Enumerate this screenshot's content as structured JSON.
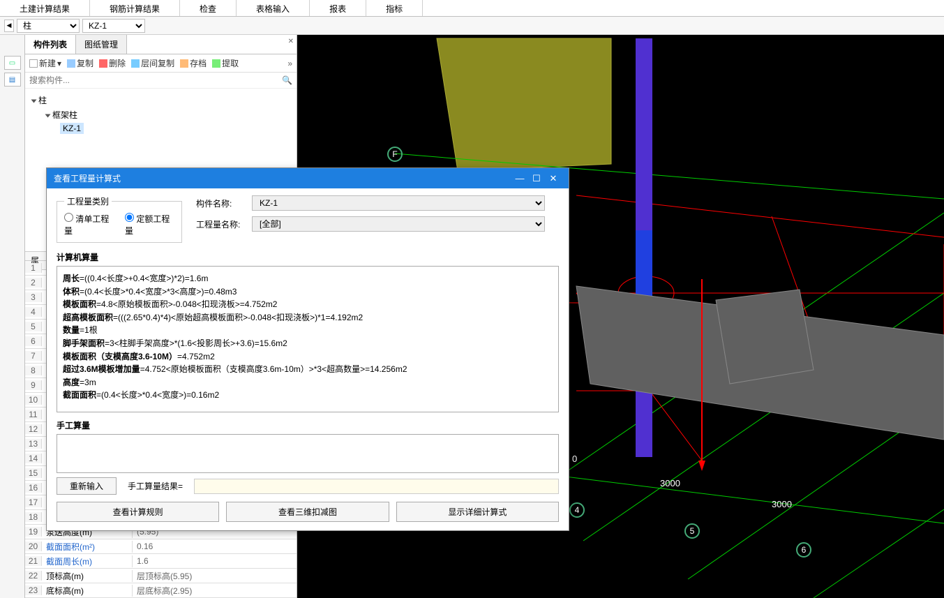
{
  "top_tabs": [
    "土建计算结果",
    "钢筋计算结果",
    "检查",
    "表格输入",
    "报表",
    "指标"
  ],
  "selectors": {
    "type": "柱",
    "name": "KZ-1"
  },
  "panel": {
    "tabs": [
      "构件列表",
      "图纸管理"
    ],
    "tools": {
      "new": "新建",
      "copy": "复制",
      "delete": "删除",
      "layer_copy": "层间复制",
      "archive": "存档",
      "extract": "提取"
    },
    "search_placeholder": "搜索构件...",
    "tree_root": "柱",
    "tree_child": "框架柱",
    "tree_leaf": "KZ-1",
    "prop_header": "属",
    "rows": [
      {
        "n": "1"
      },
      {
        "n": "2"
      },
      {
        "n": "3"
      },
      {
        "n": "4"
      },
      {
        "n": "5"
      },
      {
        "n": "6"
      },
      {
        "n": "7"
      },
      {
        "n": "8"
      },
      {
        "n": "9"
      },
      {
        "n": "10"
      },
      {
        "n": "11"
      },
      {
        "n": "12"
      },
      {
        "n": "13"
      },
      {
        "n": "14"
      },
      {
        "n": "15"
      },
      {
        "n": "16"
      },
      {
        "n": "17"
      },
      {
        "n": "18"
      },
      {
        "n": "19",
        "k": "泵送高度(m)",
        "v": "(5.95)"
      },
      {
        "n": "20",
        "k": "截面面积(m²)",
        "v": "0.16",
        "blue": true
      },
      {
        "n": "21",
        "k": "截面周长(m)",
        "v": "1.6",
        "blue": true
      },
      {
        "n": "22",
        "k": "顶标高(m)",
        "v": "层顶标高(5.95)"
      },
      {
        "n": "23",
        "k": "底标高(m)",
        "v": "层底标高(2.95)"
      }
    ]
  },
  "viewport": {
    "axis_marks": [
      "F",
      "4",
      "5",
      "6"
    ],
    "dims": [
      "0",
      "3000",
      "3000"
    ]
  },
  "dialog": {
    "title": "查看工程量计算式",
    "cat_label": "工程量类别",
    "radio_list": "清单工程量",
    "radio_quota": "定额工程量",
    "comp_name_label": "构件名称:",
    "comp_name_value": "KZ-1",
    "qty_name_label": "工程量名称:",
    "qty_name_value": "[全部]",
    "computer_section": "计算机算量",
    "calc_lines": [
      {
        "b": "周长",
        "t": "=((0.4<长度>+0.4<宽度>)*2)=1.6m"
      },
      {
        "b": "体积",
        "t": "=(0.4<长度>*0.4<宽度>*3<高度>)=0.48m3"
      },
      {
        "b": "模板面积",
        "t": "=4.8<原始模板面积>-0.048<扣现浇板>=4.752m2"
      },
      {
        "b": "超高模板面积",
        "t": "=(((2.65*0.4)*4)<原始超高模板面积>-0.048<扣现浇板>)*1=4.192m2"
      },
      {
        "b": "数量",
        "t": "=1根"
      },
      {
        "b": "脚手架面积",
        "t": "=3<柱脚手架高度>*(1.6<投影周长>+3.6)=15.6m2"
      },
      {
        "b": "模板面积（支模高度3.6-10M）",
        "t": "=4.752m2"
      },
      {
        "b": "超过3.6M模板增加量",
        "t": "=4.752<原始模板面积（支模高度3.6m-10m）>*3<超高数量>=14.256m2"
      },
      {
        "b": "高度",
        "t": "=3m"
      },
      {
        "b": "截面面积",
        "t": "=(0.4<长度>*0.4<宽度>)=0.16m2"
      }
    ],
    "manual_section": "手工算量",
    "reenter": "重新输入",
    "manual_result_label": "手工算量结果=",
    "btn_rules": "查看计算规则",
    "btn_3d": "查看三维扣减图",
    "btn_detail": "显示详细计算式"
  }
}
